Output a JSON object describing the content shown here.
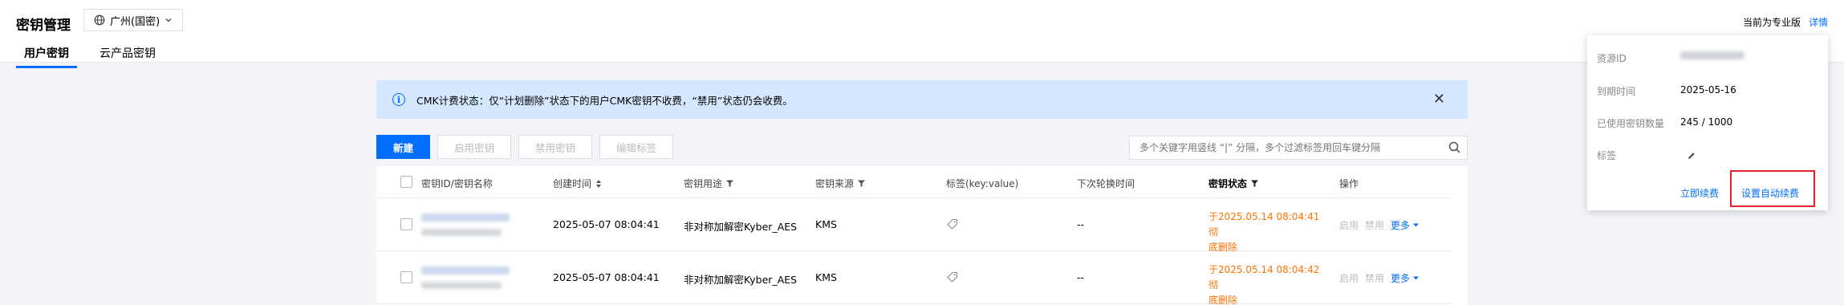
{
  "header": {
    "title": "密钥管理",
    "region": "广州(国密)",
    "tabs": [
      {
        "label": "用户密钥",
        "active": true
      },
      {
        "label": "云产品密钥",
        "active": false
      }
    ],
    "edition": "当前为专业版",
    "details_link": "详情"
  },
  "alert": {
    "text": "CMK计费状态：仅“计划删除”状态下的用户CMK密钥不收费，“禁用”状态仍会收费。"
  },
  "toolbar": {
    "new_label": "新建",
    "enable_label": "启用密钥",
    "disable_label": "禁用密钥",
    "edit_tags_label": "编辑标签"
  },
  "search": {
    "placeholder": "多个关键字用竖线 “|” 分隔，多个过滤标签用回车键分隔"
  },
  "table": {
    "columns": [
      "密钥ID/密钥名称",
      "创建时间",
      "密钥用途",
      "密钥来源",
      "标签(key:value)",
      "下次轮换时间",
      "密钥状态",
      "操作"
    ],
    "rows": [
      {
        "created": "2025-05-07 08:04:41",
        "usage": "非对称加解密Kyber_AES",
        "source": "KMS",
        "next_rotation": "--",
        "status_line1": "于2025.05.14 08:04:41彻",
        "status_line2": "底删除",
        "op_enable": "启用",
        "op_disable": "禁用",
        "op_more": "更多"
      },
      {
        "created": "2025-05-07 08:04:41",
        "usage": "非对称加解密Kyber_AES",
        "source": "KMS",
        "next_rotation": "--",
        "status_line1": "于2025.05.14 08:04:42彻",
        "status_line2": "底删除",
        "op_enable": "启用",
        "op_disable": "禁用",
        "op_more": "更多"
      }
    ]
  },
  "popover": {
    "resource_id_label": "资源ID",
    "expire_label": "到期时间",
    "expire_value": "2025-05-16",
    "used_label": "已使用密钥数量",
    "used_value": "245 / 1000",
    "tag_label": "标签",
    "renew_link": "立即续费",
    "auto_renew_link": "设置自动续费"
  },
  "colors": {
    "accent": "#006eff",
    "status_warning": "#ff7200",
    "alert_bg": "#d5e7ff",
    "highlight_box": "#e5222d"
  },
  "icons": {
    "region": "globe-icon",
    "alert": "info-icon",
    "close": "close-icon",
    "search": "search-icon",
    "tag": "tag-icon",
    "edit": "pencil-icon"
  }
}
